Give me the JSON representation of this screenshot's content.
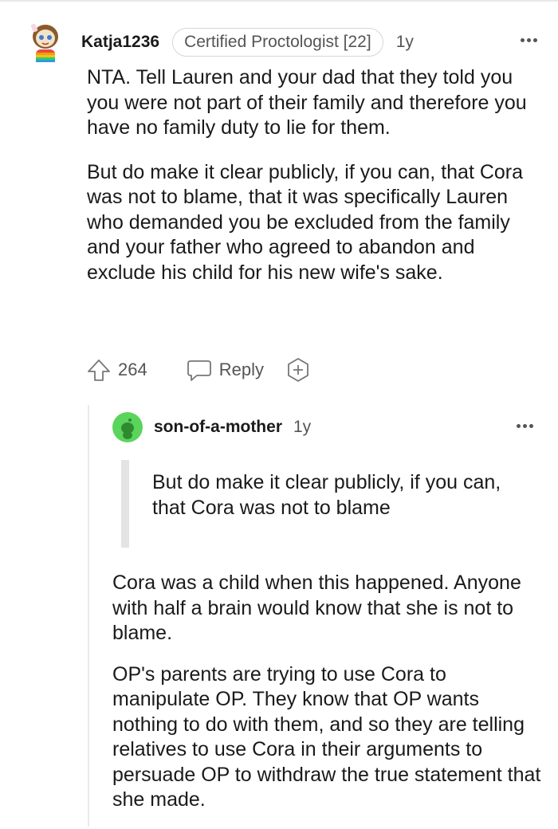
{
  "parent_comment": {
    "username": "Katja1236",
    "flair": "Certified Proctologist [22]",
    "age": "1y",
    "avatar_icon": "snoo-avatar-rainbow-icon",
    "paragraphs": [
      "NTA. Tell Lauren and your dad that they told you you were not part of their family and therefore you have no family duty to lie for them.",
      "But do make it clear publicly, if you can, that Cora was not to blame, that it was specifically Lauren who demanded you be excluded from the family and your father who agreed to abandon and exclude his child for his new wife's sake."
    ],
    "actions": {
      "upvote_icon": "upvote-arrow-icon",
      "votes": "264",
      "reply_icon": "speech-bubble-icon",
      "reply_label": "Reply",
      "award_icon": "plus-award-icon"
    }
  },
  "reply_comment": {
    "username": "son-of-a-mother",
    "age": "1y",
    "avatar_icon": "snoo-avatar-green-icon",
    "quote": "But do make it clear publicly, if you can, that Cora was not to blame",
    "paragraphs": [
      "Cora was a child when this happened. Anyone with half a brain would know that she is not to blame.",
      "OP's parents are trying to use Cora to manipulate OP. They know that OP wants nothing to do with them, and so they are telling relatives to use Cora in their arguments to persuade OP to withdraw the true statement that she made."
    ]
  },
  "colors": {
    "text": "#1a1a1b",
    "meta": "#555555",
    "quote_bar": "#e4e4e4",
    "reply_avatar_bg": "#5bd45b"
  }
}
